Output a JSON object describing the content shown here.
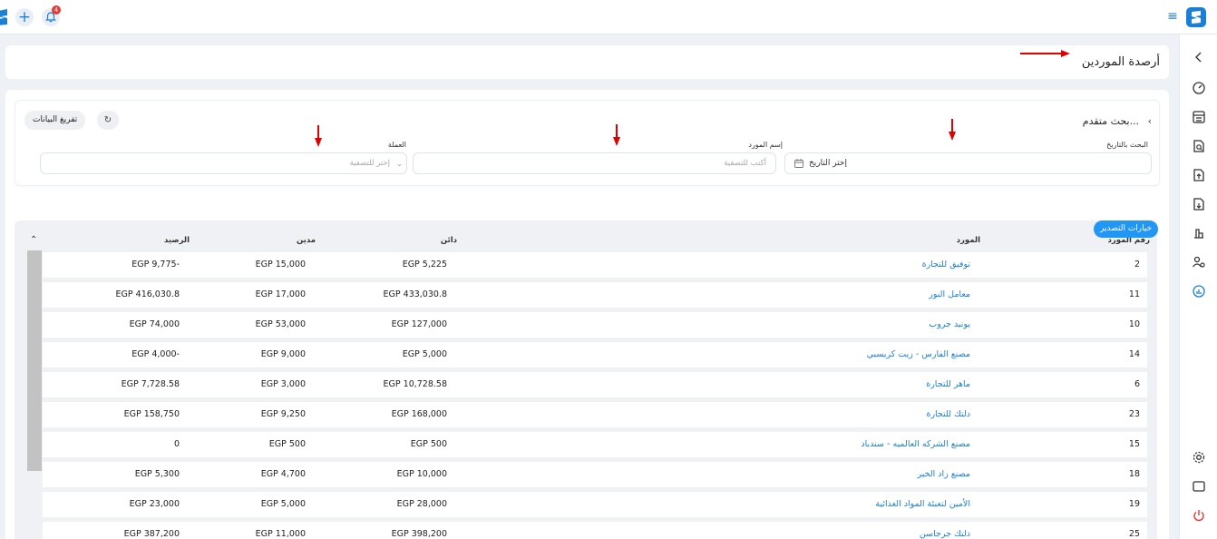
{
  "topbar": {
    "notification_count": "4"
  },
  "page": {
    "title": "أرصدة الموردين"
  },
  "filters": {
    "advanced_search_label": "بحث متقدم...",
    "date_label": "البحث بالتاريخ",
    "date_value": "إختر التاريخ",
    "supplier_label": "إسم المورد",
    "supplier_placeholder": "أكتب للتصفية",
    "currency_label": "العملة",
    "currency_placeholder": "إختر للتصفية",
    "clear_label": "تفريغ البيانات"
  },
  "export_label": "خيارات التصدير",
  "table": {
    "headers": {
      "number": "رقم المورد",
      "supplier": "المورد",
      "credit": "دائن",
      "debit": "مدين",
      "balance": "الرصيد"
    },
    "rows": [
      {
        "number": "2",
        "supplier": "توفيق للتجارة",
        "credit": "EGP 5,225",
        "debit": "EGP 15,000",
        "balance": "EGP 9,775-"
      },
      {
        "number": "11",
        "supplier": "معامل النور",
        "credit": "EGP 433,030.8",
        "debit": "EGP 17,000",
        "balance": "EGP 416,030.8"
      },
      {
        "number": "10",
        "supplier": "يونيد جروب",
        "credit": "EGP 127,000",
        "debit": "EGP 53,000",
        "balance": "EGP 74,000"
      },
      {
        "number": "14",
        "supplier": "مصنع الفارس - زيت كريسبي",
        "credit": "EGP 5,000",
        "debit": "EGP 9,000",
        "balance": "EGP 4,000-"
      },
      {
        "number": "6",
        "supplier": "ماهر للتجارة",
        "credit": "EGP 10,728.58",
        "debit": "EGP 3,000",
        "balance": "EGP 7,728.58"
      },
      {
        "number": "23",
        "supplier": "دلتك للتجارة",
        "credit": "EGP 168,000",
        "debit": "EGP 9,250",
        "balance": "EGP 158,750"
      },
      {
        "number": "15",
        "supplier": "مصنع الشركه العالميه - سندباد",
        "credit": "EGP 500",
        "debit": "EGP 500",
        "balance": "0"
      },
      {
        "number": "18",
        "supplier": "مصنع زاد الخير",
        "credit": "EGP 10,000",
        "debit": "EGP 4,700",
        "balance": "EGP 5,300"
      },
      {
        "number": "19",
        "supplier": "الأمين لتعبئة المواد الغذائية",
        "credit": "EGP 28,000",
        "debit": "EGP 5,000",
        "balance": "EGP 23,000"
      },
      {
        "number": "25",
        "supplier": "دلتك جرجاسن",
        "credit": "EGP 398,200",
        "debit": "EGP 11,000",
        "balance": "EGP 387,200"
      }
    ]
  },
  "colors": {
    "accent": "#1a7fd6",
    "export_button": "#2196f3",
    "annotation_arrow": "#e00000",
    "power_icon": "#e53935"
  }
}
